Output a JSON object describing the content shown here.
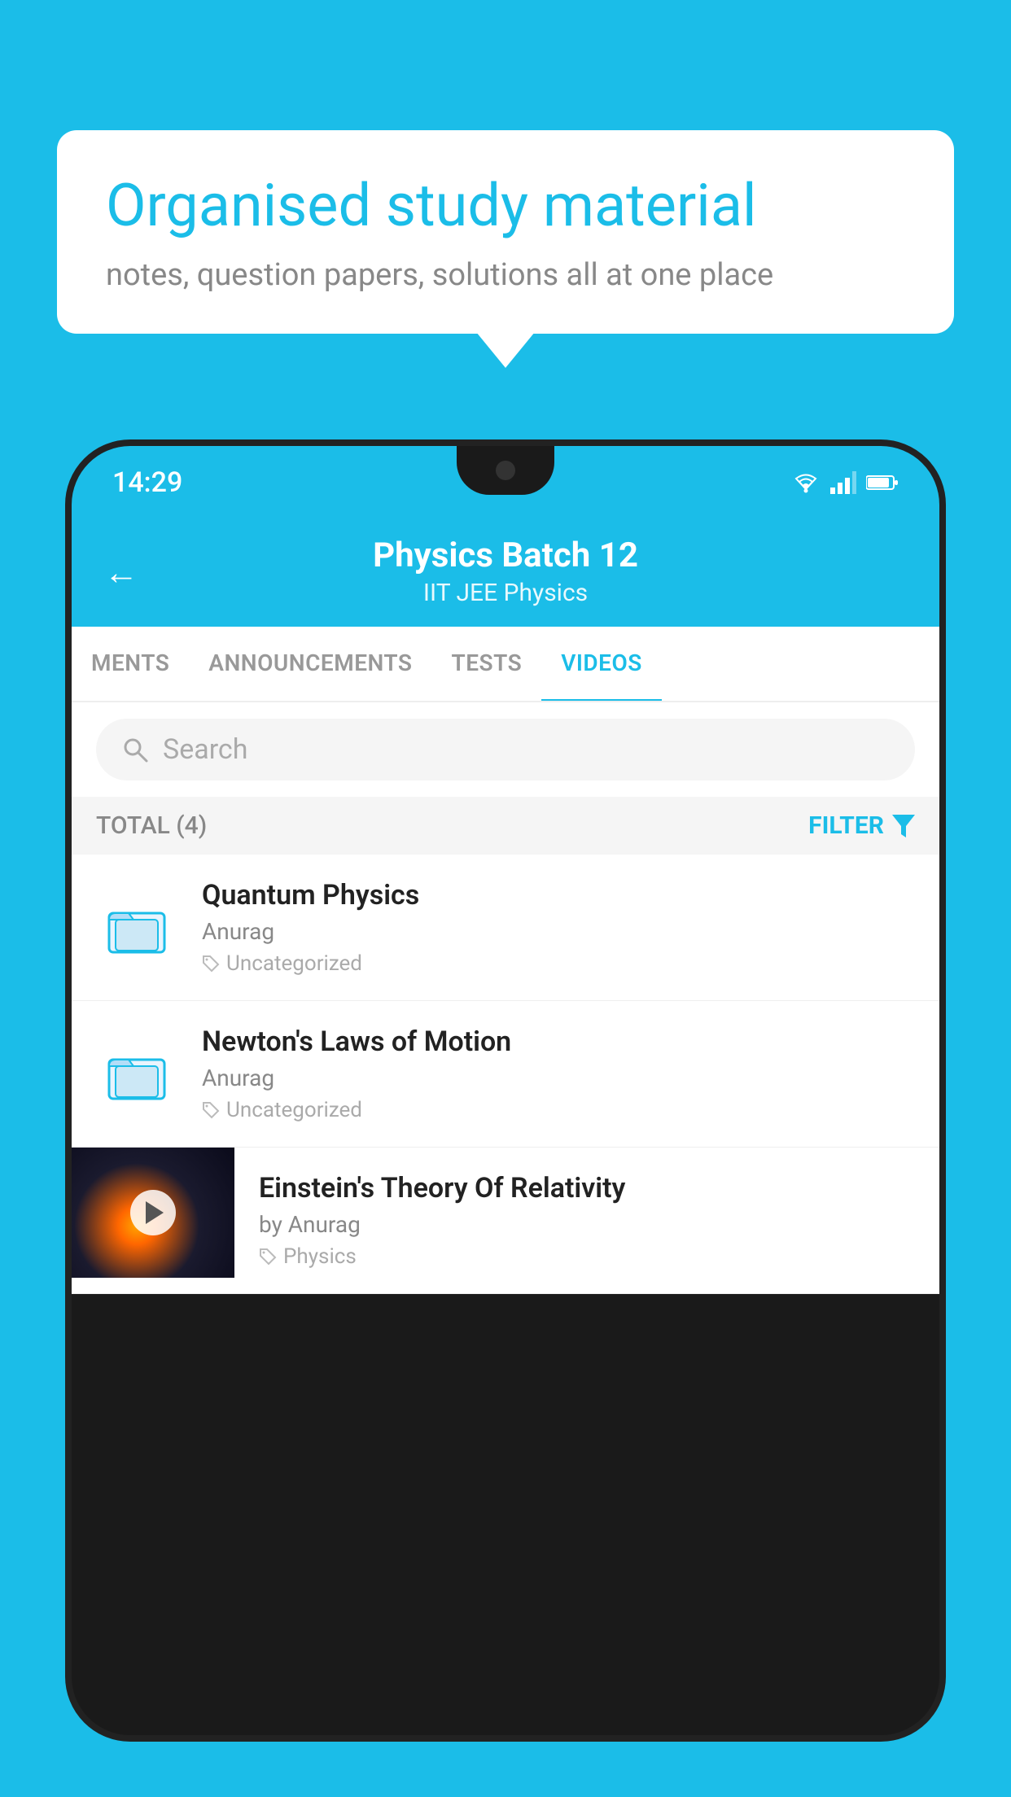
{
  "background_color": "#1bbde8",
  "speech_bubble": {
    "title": "Organised study material",
    "subtitle": "notes, question papers, solutions all at one place"
  },
  "phone": {
    "status_bar": {
      "time": "14:29"
    },
    "header": {
      "title": "Physics Batch 12",
      "subtitle": "IIT JEE    Physics",
      "back_label": "←"
    },
    "tabs": [
      {
        "label": "MENTS",
        "active": false
      },
      {
        "label": "ANNOUNCEMENTS",
        "active": false
      },
      {
        "label": "TESTS",
        "active": false
      },
      {
        "label": "VIDEOS",
        "active": true
      }
    ],
    "search": {
      "placeholder": "Search"
    },
    "filter_row": {
      "total_label": "TOTAL (4)",
      "filter_label": "FILTER"
    },
    "videos": [
      {
        "id": 1,
        "title": "Quantum Physics",
        "author": "Anurag",
        "tag": "Uncategorized",
        "type": "folder"
      },
      {
        "id": 2,
        "title": "Newton's Laws of Motion",
        "author": "Anurag",
        "tag": "Uncategorized",
        "type": "folder"
      },
      {
        "id": 3,
        "title": "Einstein's Theory Of Relativity",
        "author": "by Anurag",
        "tag": "Physics",
        "type": "thumbnail"
      }
    ]
  }
}
